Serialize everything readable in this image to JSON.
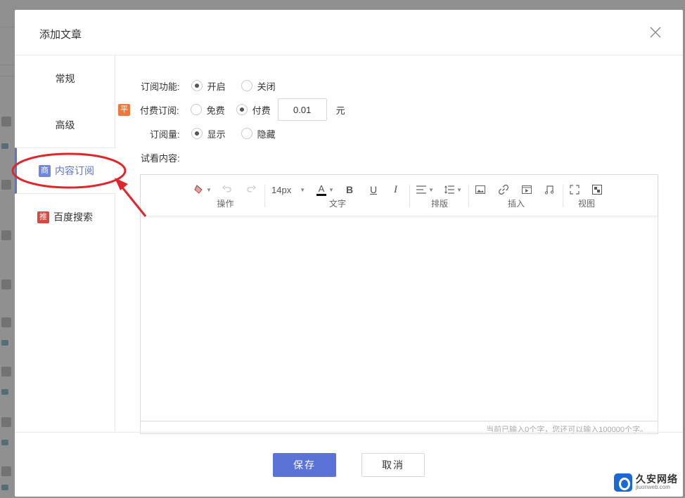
{
  "modal": {
    "title": "添加文章",
    "close_icon": "close-x-icon"
  },
  "sidebar": {
    "items": [
      {
        "label": "常规",
        "badge": ""
      },
      {
        "label": "高级",
        "badge": ""
      },
      {
        "label": "内容订阅",
        "badge": "商",
        "active": true
      },
      {
        "label": "百度搜索",
        "badge": "推"
      }
    ]
  },
  "form": {
    "subscription": {
      "label": "订阅功能:",
      "options": [
        "开启",
        "关闭"
      ],
      "selected": "开启"
    },
    "paid": {
      "tag": "平",
      "label": "付费订阅:",
      "options": [
        "免费",
        "付费"
      ],
      "selected": "付费",
      "amount": "0.01",
      "unit": "元"
    },
    "count": {
      "label": "订阅量:",
      "options": [
        "显示",
        "隐藏"
      ],
      "selected": "显示"
    },
    "preview_label": "试看内容:"
  },
  "editor": {
    "groups": [
      {
        "caption": "操作"
      },
      {
        "caption": "文字"
      },
      {
        "caption": "排版"
      },
      {
        "caption": "插入"
      },
      {
        "caption": "视图"
      }
    ],
    "font_size": "14px",
    "font_color_letter": "A",
    "bold": "B",
    "underline": "U",
    "italic": "I",
    "footer_text": "当前已输入0个字，您还可以输入100000个字。"
  },
  "footer": {
    "save_label": "保存",
    "cancel_label": "取消"
  },
  "watermark": {
    "cn": "久安网络",
    "en": "jiuonweb.com"
  },
  "colors": {
    "primary": "#5b73d6",
    "badge_blue": "#6f86df",
    "badge_red": "#d9473e",
    "badge_orange": "#ec7a3d",
    "annotation_red": "#e0262a"
  }
}
